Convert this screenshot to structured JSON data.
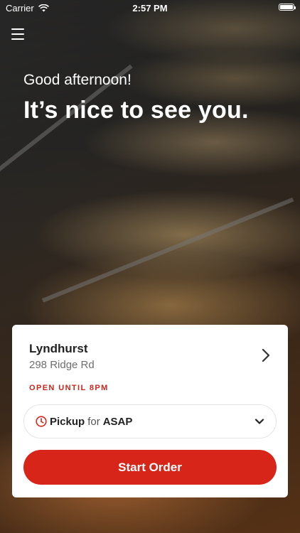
{
  "status_bar": {
    "carrier": "Carrier",
    "time": "2:57 PM",
    "battery_level": 1.0
  },
  "header": {
    "menu_icon": "hamburger-menu-icon",
    "greeting": "Good afternoon!",
    "headline": "It’s nice to see you."
  },
  "store": {
    "name": "Lyndhurst",
    "address": "298 Ridge Rd",
    "hours": "OPEN UNTIL 8PM",
    "chevron_icon": "chevron-right-icon"
  },
  "order_options": {
    "icon": "clock-icon",
    "mode": "Pickup",
    "connector": "for",
    "time": "ASAP",
    "dropdown_icon": "chevron-down-icon"
  },
  "actions": {
    "start_order_label": "Start Order"
  },
  "colors": {
    "accent": "#d8251a",
    "hours_text": "#c8261b"
  }
}
